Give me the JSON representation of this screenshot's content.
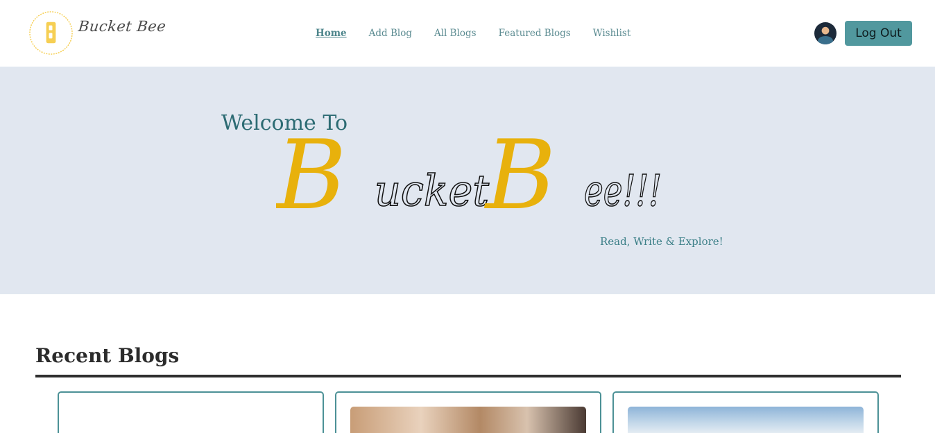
{
  "nav": {
    "logo_alt": "BucketBee logo",
    "logo_text": "Bucket Bee",
    "links": [
      {
        "label": "Home",
        "active": true
      },
      {
        "label": "Add Blog",
        "active": false
      },
      {
        "label": "All Blogs",
        "active": false
      },
      {
        "label": "Featured Blogs",
        "active": false
      },
      {
        "label": "Wishlist",
        "active": false
      }
    ],
    "logout_label": "Log Out"
  },
  "hero": {
    "welcome": "Welcome To",
    "brand_first_initial": "B",
    "brand_first_rest": "ucket",
    "brand_second_initial": "B",
    "brand_second_rest": "ee!!!",
    "tagline": "Read, Write & Explore!"
  },
  "recent": {
    "title": "Recent Blogs"
  },
  "colors": {
    "accent": "#51989e",
    "brand_yellow": "#e8b10c",
    "hero_bg": "#e1e7f0",
    "heading_teal": "#2c6b73"
  }
}
